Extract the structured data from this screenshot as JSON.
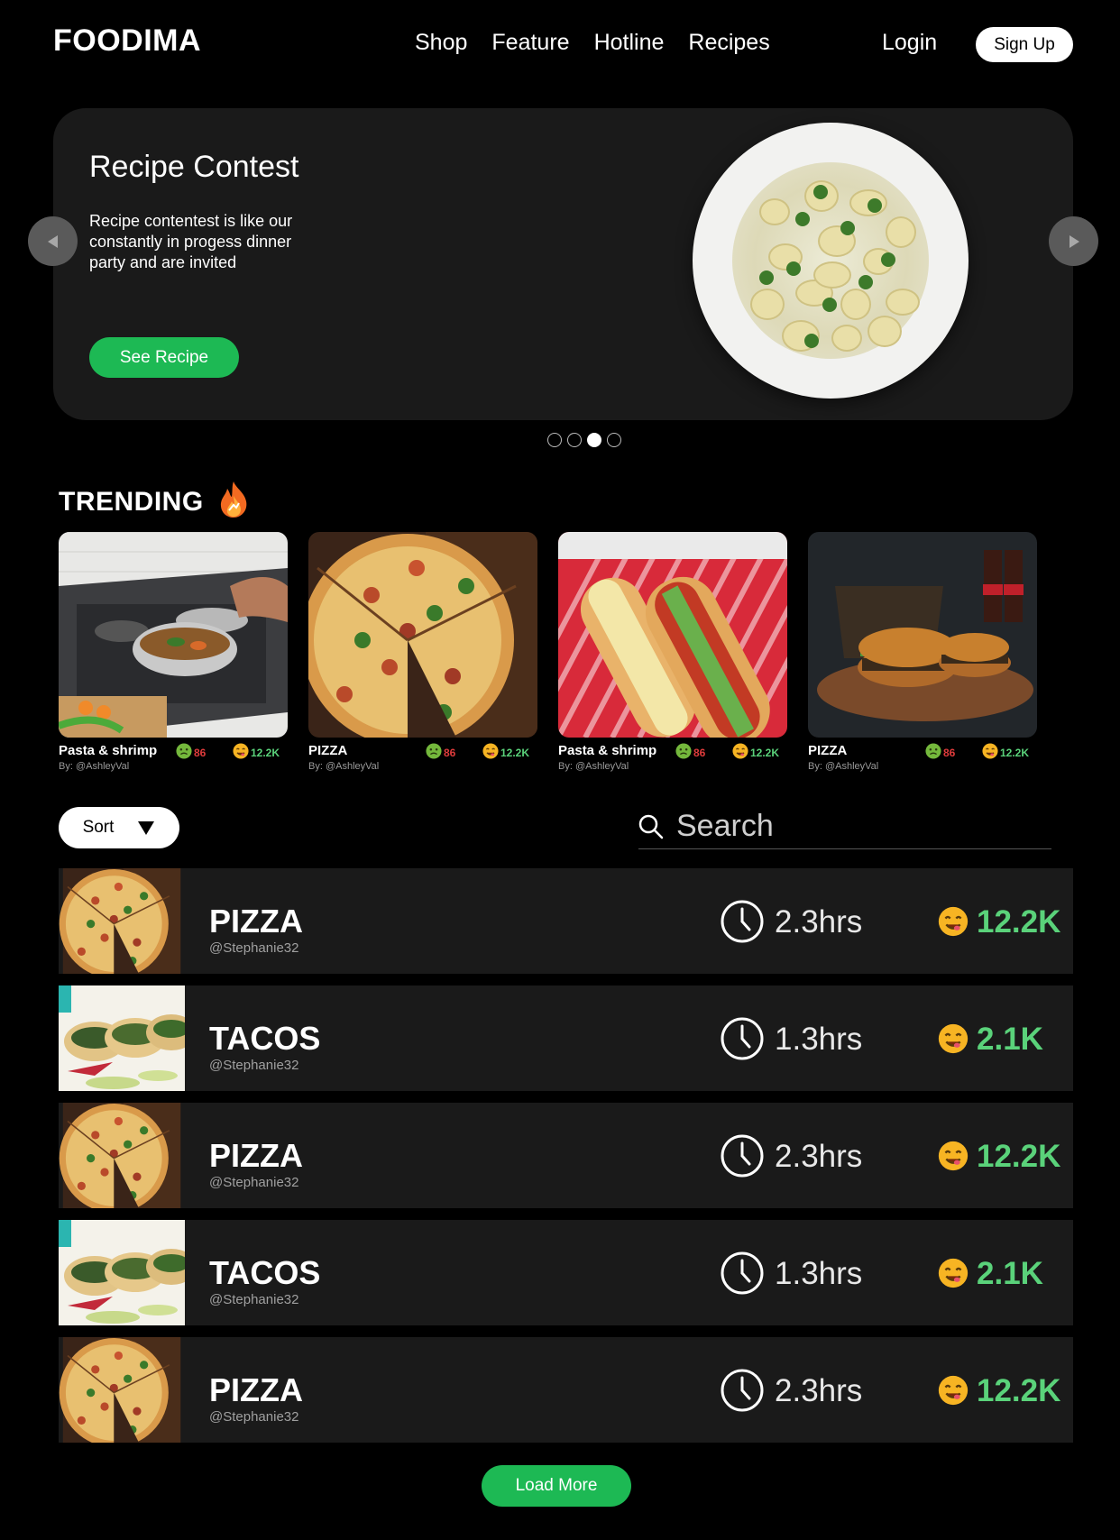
{
  "header": {
    "logo": "FOODIMA",
    "nav": [
      "Shop",
      "Feature",
      "Hotline",
      "Recipes"
    ],
    "login": "Login",
    "signup": "Sign Up"
  },
  "hero": {
    "title": "Recipe Contest",
    "description": "Recipe contentest is like our constantly in progess dinner party and are invited",
    "button": "See Recipe",
    "slides_total": 4,
    "active_slide": 3
  },
  "trending": {
    "title": "TRENDING",
    "items": [
      {
        "name": "Pasta & shrimp",
        "by": "By: @AshleyVal",
        "dislikes": "86",
        "likes": "12.2K",
        "image": "cooking-pot"
      },
      {
        "name": "PIZZA",
        "by": "By: @AshleyVal",
        "dislikes": "86",
        "likes": "12.2K",
        "image": "pizza"
      },
      {
        "name": "Pasta & shrimp",
        "by": "By: @AshleyVal",
        "dislikes": "86",
        "likes": "12.2K",
        "image": "hotdogs"
      },
      {
        "name": "PIZZA",
        "by": "By: @AshleyVal",
        "dislikes": "86",
        "likes": "12.2K",
        "image": "burgers"
      }
    ]
  },
  "controls": {
    "sort": "Sort",
    "search_placeholder": "Search"
  },
  "recipes": [
    {
      "name": "PIZZA",
      "user": "@Stephanie32",
      "time": "2.3hrs",
      "likes": "12.2K",
      "image": "pizza"
    },
    {
      "name": "TACOS",
      "user": "@Stephanie32",
      "time": "1.3hrs",
      "likes": "2.1K",
      "image": "tacos"
    },
    {
      "name": "PIZZA",
      "user": "@Stephanie32",
      "time": "2.3hrs",
      "likes": "12.2K",
      "image": "pizza"
    },
    {
      "name": "TACOS",
      "user": "@Stephanie32",
      "time": "1.3hrs",
      "likes": "2.1K",
      "image": "tacos"
    },
    {
      "name": "PIZZA",
      "user": "@Stephanie32",
      "time": "2.3hrs",
      "likes": "12.2K",
      "image": "pizza"
    }
  ],
  "load_more": "Load More",
  "colors": {
    "accent": "#1db954",
    "likes": "#5ad27a",
    "dislikes": "#e03c3c",
    "card": "#1a1a1a"
  }
}
